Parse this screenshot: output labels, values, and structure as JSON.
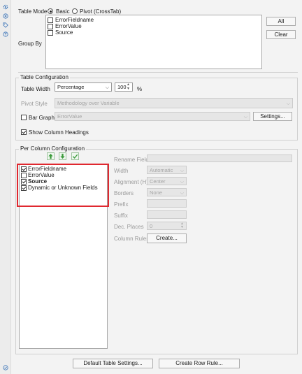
{
  "sidebar": {
    "icons": [
      "settings-gear-icon",
      "close-circle-icon",
      "tag-icon",
      "help-icon",
      "check-circle-icon"
    ]
  },
  "table_mode": {
    "label": "Table Mode",
    "basic_label": "Basic",
    "pivot_label": "Pivot (CrossTab)",
    "selected": "Basic"
  },
  "group_by": {
    "label": "Group By",
    "fields": [
      {
        "label": "ErrorFieldname",
        "checked": false
      },
      {
        "label": "ErrorValue",
        "checked": false
      },
      {
        "label": "Source",
        "checked": false
      }
    ],
    "all_button": "All",
    "clear_button": "Clear"
  },
  "table_config": {
    "title": "Table Configuration",
    "width_label": "Table Width",
    "width_mode": "Percentage",
    "width_value": "100",
    "width_unit": "%",
    "pivot_style_label": "Pivot Style",
    "pivot_style_value": "Methodology over Variable",
    "bar_graph_label": "Bar Graph",
    "bar_graph_checked": false,
    "bar_graph_value": "ErrorValue",
    "settings_button": "Settings...",
    "show_headings_label": "Show Column Headings",
    "show_headings_checked": true
  },
  "per_column": {
    "title": "Per Column Configuration",
    "toolbar_icons": [
      "move-up-icon",
      "move-down-icon",
      "check-all-icon"
    ],
    "items": [
      {
        "label": "ErrorFieldname",
        "checked": true,
        "bold": false
      },
      {
        "label": "ErrorValue",
        "checked": false,
        "bold": false
      },
      {
        "label": "Source",
        "checked": true,
        "bold": true
      },
      {
        "label": "Dynamic or Unknown Fields",
        "checked": true,
        "bold": false
      }
    ],
    "rename_field_label": "Rename Field",
    "width_label": "Width",
    "width_value": "Automatic",
    "alignment_label": "Alignment (H)",
    "alignment_value": "Center",
    "borders_label": "Borders",
    "borders_value": "None",
    "prefix_label": "Prefix",
    "suffix_label": "Suffix",
    "dec_places_label": "Dec. Places",
    "dec_places_value": "0",
    "column_rules_label": "Column Rules",
    "create_button": "Create..."
  },
  "footer": {
    "default_settings_button": "Default Table Settings...",
    "create_row_rule_button": "Create Row Rule..."
  },
  "colors": {
    "highlight": "#e0282f",
    "accent_green": "#3a9a3a"
  }
}
